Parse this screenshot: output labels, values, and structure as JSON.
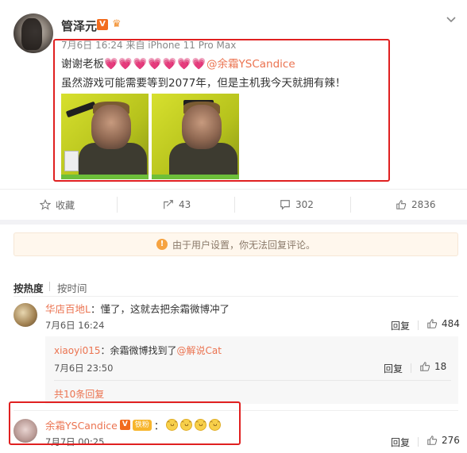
{
  "post": {
    "username": "管泽元",
    "verified_badge": "V",
    "meta": "7月6日 16:24 来自 iPhone 11 Pro Max",
    "line1_prefix": "谢谢老板",
    "hearts": "💗💗💗💗💗💗💗",
    "line1_mention": "@余霜YSCandice",
    "line2": "虽然游戏可能需要等到2077年，但是主机我今天就拥有辣！",
    "highlight_color": "#e02020"
  },
  "actions": {
    "favorite_label": "收藏",
    "forward_count": "43",
    "comment_count": "302",
    "like_count": "2836"
  },
  "notice": {
    "icon": "!",
    "text": "由于用户设置，你无法回复评论。"
  },
  "sort": {
    "by_hot": "按热度",
    "by_time": "按时间"
  },
  "comments": [
    {
      "name": "华店百地L",
      "text": "：懂了，这就去把余霜微博冲了",
      "time": "7月6日 16:24",
      "reply_label": "回复",
      "likes": "484"
    }
  ],
  "subreply": {
    "name": "xiaoyi015",
    "text": "：余霜微博找到了",
    "mention": "@解说Cat",
    "time": "7月6日 23:50",
    "reply_label": "回复",
    "likes": "18",
    "more": "共10条回复"
  },
  "last_comment": {
    "name": "余霜YSCandice",
    "verified_badge": "V",
    "fan_badge": "铁粉",
    "colon": "：",
    "emoji": "😁",
    "time": "7月7日 00:25",
    "reply_label": "回复",
    "likes": "276"
  }
}
